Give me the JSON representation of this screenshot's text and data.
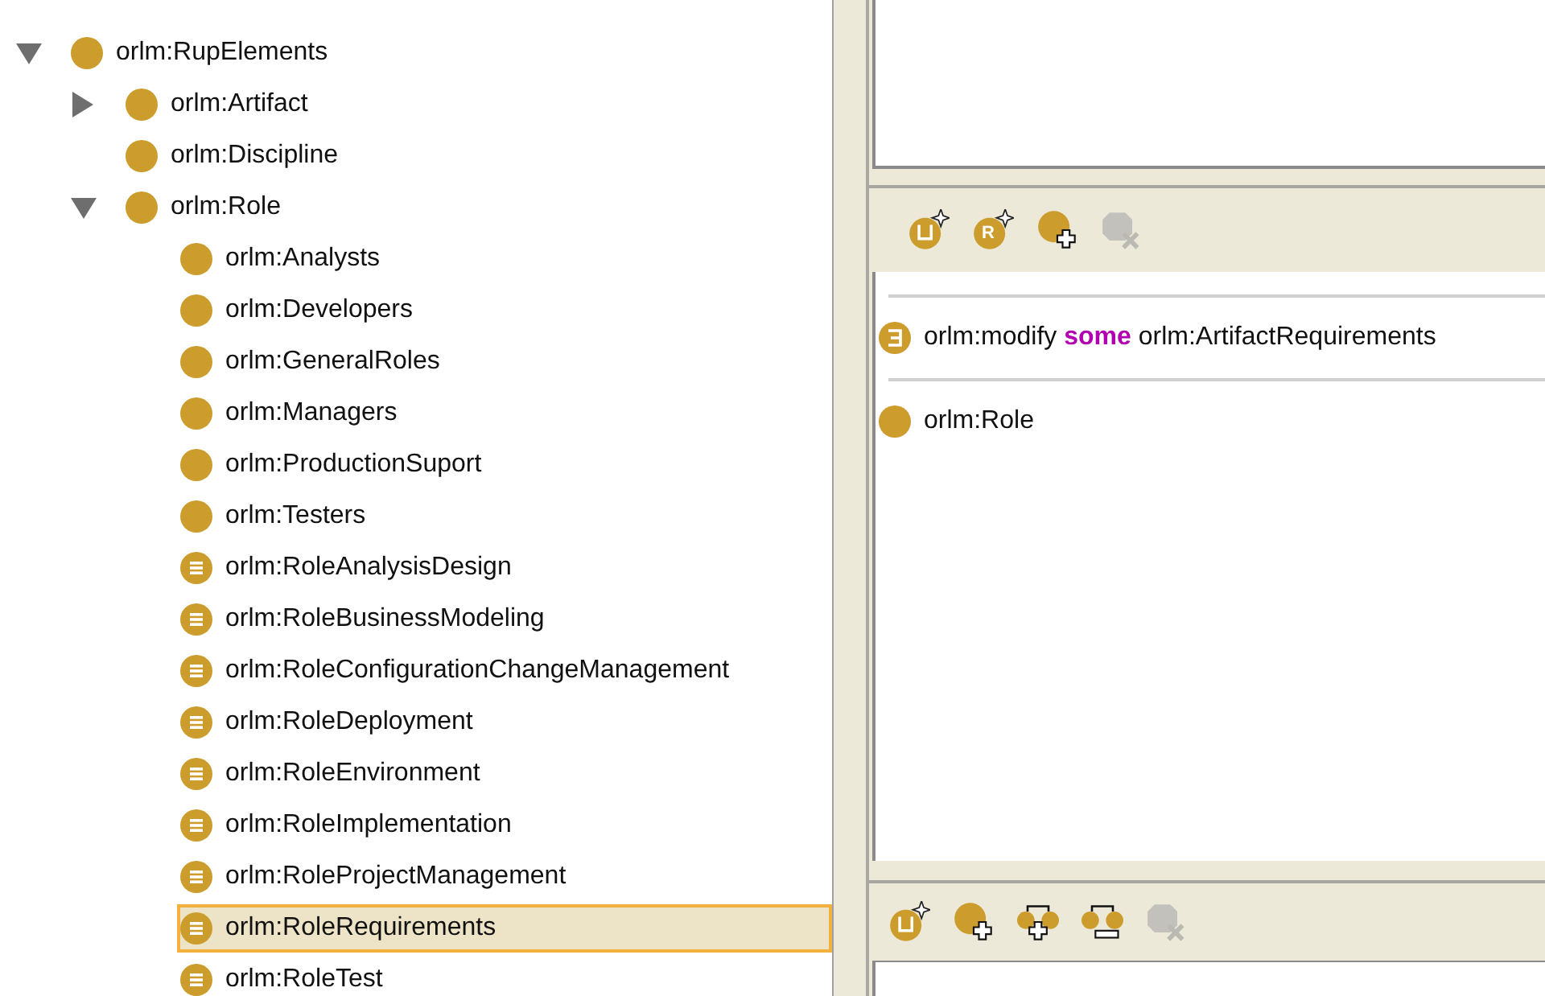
{
  "class_tree": [
    {
      "label": "orlm:RupElements",
      "kind": "class",
      "expanded": true,
      "selected": false,
      "children": [
        {
          "label": "orlm:Artifact",
          "kind": "class",
          "expanded": false,
          "selected": false
        },
        {
          "label": "orlm:Discipline",
          "kind": "class",
          "selected": false
        },
        {
          "label": "orlm:Role",
          "kind": "class",
          "expanded": true,
          "selected": false,
          "children": [
            {
              "label": "orlm:Analysts",
              "kind": "class",
              "selected": false
            },
            {
              "label": "orlm:Developers",
              "kind": "class",
              "selected": false
            },
            {
              "label": "orlm:GeneralRoles",
              "kind": "class",
              "selected": false
            },
            {
              "label": "orlm:Managers",
              "kind": "class",
              "selected": false
            },
            {
              "label": "orlm:ProductionSuport",
              "kind": "class",
              "selected": false
            },
            {
              "label": "orlm:Testers",
              "kind": "class",
              "selected": false
            },
            {
              "label": "orlm:RoleAnalysisDesign",
              "kind": "defined",
              "selected": false
            },
            {
              "label": "orlm:RoleBusinessModeling",
              "kind": "defined",
              "selected": false
            },
            {
              "label": "orlm:RoleConfigurationChangeManagement",
              "kind": "defined",
              "selected": false
            },
            {
              "label": "orlm:RoleDeployment",
              "kind": "defined",
              "selected": false
            },
            {
              "label": "orlm:RoleEnvironment",
              "kind": "defined",
              "selected": false
            },
            {
              "label": "orlm:RoleImplementation",
              "kind": "defined",
              "selected": false
            },
            {
              "label": "orlm:RoleProjectManagement",
              "kind": "defined",
              "selected": false
            },
            {
              "label": "orlm:RoleRequirements",
              "kind": "defined",
              "selected": true
            },
            {
              "label": "orlm:RoleTest",
              "kind": "defined",
              "selected": false
            }
          ]
        }
      ]
    }
  ],
  "definition_toolbar": [
    {
      "kind": "union-star",
      "disabled": false
    },
    {
      "kind": "letter-star",
      "glyph": "R",
      "disabled": false
    },
    {
      "kind": "class-plus",
      "disabled": false
    },
    {
      "kind": "delete",
      "disabled": true
    }
  ],
  "expressions": [
    {
      "kind": "restriction",
      "text": "orlm:modify **some** orlm:ArtifactRequirements"
    },
    {
      "kind": "class",
      "text": "orlm:Role"
    }
  ],
  "hierarchy_toolbar": [
    {
      "kind": "union-star",
      "disabled": false
    },
    {
      "kind": "class-plus",
      "disabled": false
    },
    {
      "kind": "split-plus",
      "disabled": false
    },
    {
      "kind": "split-minus",
      "disabled": false
    },
    {
      "kind": "delete",
      "disabled": true
    }
  ]
}
